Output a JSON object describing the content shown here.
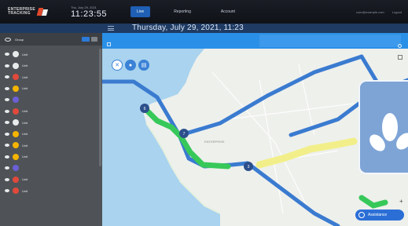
{
  "header": {
    "logo_line1": "ENTERPRISE",
    "logo_line2": "TRACKING",
    "date": "Thu, July 29, 2021",
    "time": "11:23:55",
    "tabs": [
      {
        "label": "Live",
        "active": true
      },
      {
        "label": "Reporting",
        "active": false
      },
      {
        "label": "Account",
        "active": false
      }
    ],
    "user_email": "user@example.com",
    "logout_label": "Logout"
  },
  "subbar": {
    "title": "Thursday, July 29, 2021, 11:23"
  },
  "sidebar": {
    "group_label": "Group",
    "vehicles": [
      {
        "name": "Unit",
        "color": "#e8eaec",
        "icon": "truck-icon"
      },
      {
        "name": "Unit",
        "color": "#e8eaec",
        "icon": "truck-icon"
      },
      {
        "name": "Unit",
        "color": "#e0493b",
        "icon": "alert-icon"
      },
      {
        "name": "Unit",
        "color": "#f4b400",
        "icon": "truck-icon"
      },
      {
        "name": "",
        "color": "#6b5fd6",
        "icon": "truck-icon"
      },
      {
        "name": "Unit",
        "color": "#e0493b",
        "icon": "alert-icon"
      },
      {
        "name": "Unit",
        "color": "#e8eaec",
        "icon": "truck-icon"
      },
      {
        "name": "Unit",
        "color": "#f4b400",
        "icon": "truck-icon"
      },
      {
        "name": "Unit",
        "color": "#f4b400",
        "icon": "truck-icon"
      },
      {
        "name": "Unit",
        "color": "#f4b400",
        "icon": "truck-icon"
      },
      {
        "name": "",
        "color": "#6b5fd6",
        "icon": "truck-icon"
      },
      {
        "name": "Unit",
        "color": "#e0493b",
        "icon": "truck-icon"
      },
      {
        "name": "Unit",
        "color": "#e0493b",
        "icon": "truck-icon"
      }
    ]
  },
  "map": {
    "assist_label": "Assistance",
    "markers": [
      "6",
      "7",
      "3"
    ],
    "labels": [
      "ENTERPRISE"
    ]
  },
  "colors": {
    "accent": "#2a8fe6",
    "route_main": "#3a7bd0",
    "route_green": "#37c85a",
    "route_yellow": "#f2ef8a",
    "water": "#a9d3ee",
    "land": "#eef0ec"
  }
}
